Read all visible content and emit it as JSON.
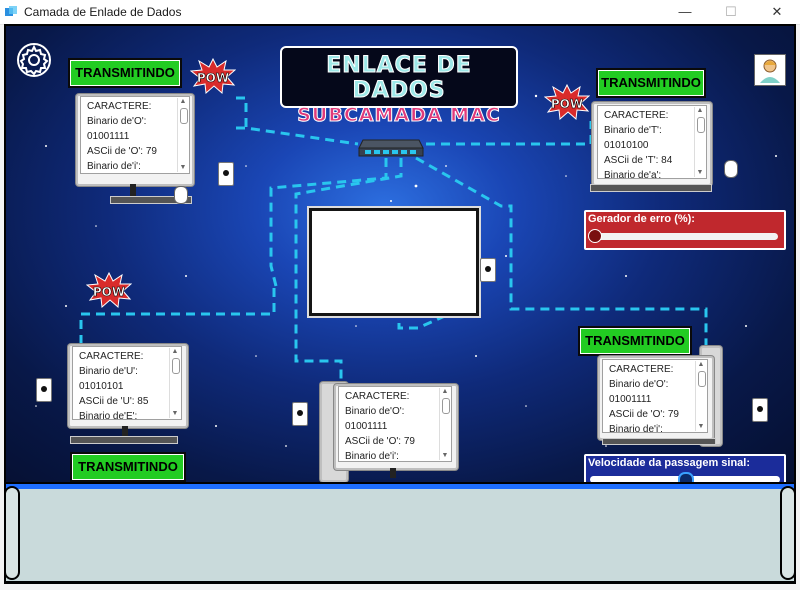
{
  "window": {
    "title": "Camada de Enlade de Dados",
    "min_label": "—",
    "max_label": "☐",
    "close_label": "✕"
  },
  "header": {
    "line1": "ENLACE DE DADOS",
    "line2": "SUBCAMADA MAC"
  },
  "nodes": [
    {
      "id": "top-left",
      "status": "TRANSMITINDO",
      "lines": [
        "CARACTERE:",
        "Binario de'O':",
        "01001111",
        "ASCii de 'O': 79",
        "Binario de'i':"
      ]
    },
    {
      "id": "top-right",
      "status": "TRANSMITINDO",
      "lines": [
        "CARACTERE:",
        "Binario de'T':",
        "01010100",
        "ASCii de 'T': 84",
        "Binario de'a':"
      ]
    },
    {
      "id": "bottom-left",
      "status": "TRANSMITINDO",
      "lines": [
        "CARACTERE:",
        "Binario de'U':",
        "01010101",
        "ASCii de 'U': 85",
        "Binario de'E':"
      ]
    },
    {
      "id": "bottom-center",
      "status": "",
      "lines": [
        "CARACTERE:",
        "Binario de'O':",
        "01001111",
        "ASCii de 'O': 79",
        "Binario de'i':"
      ]
    },
    {
      "id": "bottom-right",
      "status": "TRANSMITINDO",
      "lines": [
        "CARACTERE:",
        "Binario de'O':",
        "01001111",
        "ASCii de 'O': 79",
        "Binario de'i':"
      ]
    }
  ],
  "pow_label": "POW",
  "error_generator": {
    "label": "Gerador de erro (%):",
    "value": 0
  },
  "signal_speed": {
    "label": "Velocidade da passagem sinal:",
    "value": 0.5
  },
  "colors": {
    "status_badge": "#22cc22",
    "wire": "#29c6ee",
    "error_panel": "#c0282d",
    "speed_panel": "#1b2c9a",
    "pipe": "#c9dadb"
  },
  "icons": [
    "app-icon",
    "gear-icon",
    "avatar-icon",
    "switch-icon",
    "power-outlet-icon",
    "pow-icon"
  ]
}
